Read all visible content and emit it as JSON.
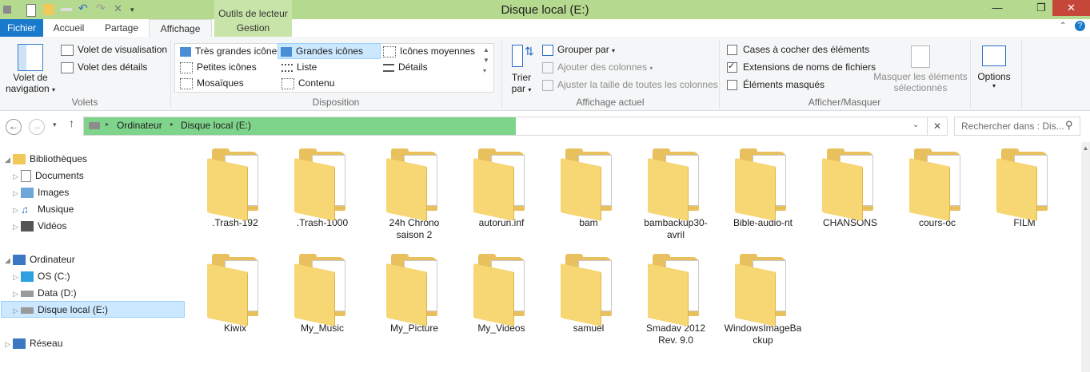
{
  "window": {
    "title": "Disque local (E:)",
    "contextual_group": "Outils de lecteur",
    "controls": {
      "minimize": "—",
      "maximize": "❐",
      "close": "✕"
    }
  },
  "tabs": {
    "fichier": "Fichier",
    "accueil": "Accueil",
    "partage": "Partage",
    "affichage": "Affichage",
    "gestion": "Gestion"
  },
  "ribbon": {
    "volets": {
      "label": "Volets",
      "nav_pane_line1": "Volet de",
      "nav_pane_line2": "navigation",
      "preview": "Volet de visualisation",
      "details": "Volet des détails"
    },
    "disposition": {
      "label": "Disposition",
      "items": {
        "tres_grandes": "Très grandes icônes",
        "grandes": "Grandes icônes",
        "moyennes": "Icônes moyennes",
        "petites": "Petites icônes",
        "liste": "Liste",
        "details": "Détails",
        "mosaiques": "Mosaïques",
        "contenu": "Contenu"
      }
    },
    "affichage_actuel": {
      "label": "Affichage actuel",
      "sort_line1": "Trier",
      "sort_line2": "par",
      "group_by": "Grouper par",
      "add_columns": "Ajouter des colonnes",
      "fit_columns": "Ajuster la taille de toutes les colonnes"
    },
    "afficher_masquer": {
      "label": "Afficher/Masquer",
      "checkboxes": "Cases à cocher des éléments",
      "extensions": "Extensions de noms de fichiers",
      "hidden": "Éléments masqués",
      "hide_sel_line1": "Masquer les éléments",
      "hide_sel_line2": "sélectionnés",
      "extensions_checked": true
    },
    "options": {
      "label": "Options"
    }
  },
  "address": {
    "crumb1": "Ordinateur",
    "crumb2": "Disque local (E:)",
    "search_placeholder": "Rechercher dans : Dis..."
  },
  "navpane": {
    "bibliotheques": "Bibliothèques",
    "documents": "Documents",
    "images": "Images",
    "musique": "Musique",
    "videos": "Vidéos",
    "ordinateur": "Ordinateur",
    "os": "OS (C:)",
    "data": "Data (D:)",
    "disque": "Disque local (E:)",
    "reseau": "Réseau"
  },
  "folders": [
    {
      "name": ".Trash-192"
    },
    {
      "name": ".Trash-1000"
    },
    {
      "name": "24h Chrono saison 2"
    },
    {
      "name": "autorun.inf"
    },
    {
      "name": "bam"
    },
    {
      "name": "bambackup30-avril"
    },
    {
      "name": "Bible-audio-nt"
    },
    {
      "name": "CHANSONS"
    },
    {
      "name": "cours-oc"
    },
    {
      "name": "FILM"
    },
    {
      "name": "Kiwix"
    },
    {
      "name": "My_Music"
    },
    {
      "name": "My_Picture"
    },
    {
      "name": "My_Videos"
    },
    {
      "name": "samuel"
    },
    {
      "name": "Smadav 2012 Rev. 9.0"
    },
    {
      "name": "WindowsImageBackup"
    }
  ],
  "colors": {
    "title_bar": "#b5d98f",
    "address_fill": "#7fd48c",
    "tab_fichier": "#1979ca",
    "selection": "#cce8ff"
  }
}
